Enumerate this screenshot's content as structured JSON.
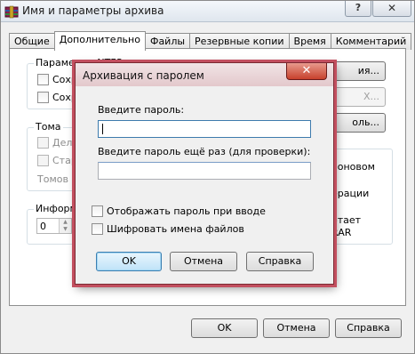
{
  "window": {
    "title": "Имя и параметры архива",
    "help_label": "?",
    "close_label": "✕"
  },
  "tabs": [
    {
      "label": "Общие"
    },
    {
      "label": "Дополнительно"
    },
    {
      "label": "Файлы"
    },
    {
      "label": "Резервные копии"
    },
    {
      "label": "Время"
    },
    {
      "label": "Комментарий"
    }
  ],
  "panel": {
    "ntfs_group_title": "Параметры NTFS",
    "ntfs_item_1": "Сохра",
    "ntfs_item_2": "Сохра",
    "volumes_group_title": "Тома",
    "volumes_item_1": "Дела",
    "volumes_item_2": "Старь",
    "volumes_text": "Томов д",
    "info_group_title": "Информ",
    "info_spin_value": "0",
    "btn_1_label": "ия...",
    "btn_2_label": "X...",
    "btn_3_label": "оль...",
    "right_text_1": "ооновом",
    "right_text_2": "ерации",
    "right_text_3": "отает",
    "right_text_4": "RAR"
  },
  "footer": {
    "ok_label": "OK",
    "cancel_label": "Отмена",
    "help_label": "Справка"
  },
  "dialog": {
    "title": "Архивация с паролем",
    "close_label": "✕",
    "password_label": "Введите пароль:",
    "password_value": "",
    "confirm_label": "Введите пароль ещё раз (для проверки):",
    "confirm_value": "",
    "show_password_label": "Отображать пароль при вводе",
    "show_password_checked": false,
    "encrypt_names_label": "Шифровать имена файлов",
    "encrypt_names_checked": false,
    "ok_label": "OK",
    "cancel_label": "Отмена",
    "help_label": "Справка"
  },
  "colors": {
    "dialog_border": "#c24f5f",
    "close_button": "#c7412c",
    "default_button": "#3c7fb1"
  }
}
